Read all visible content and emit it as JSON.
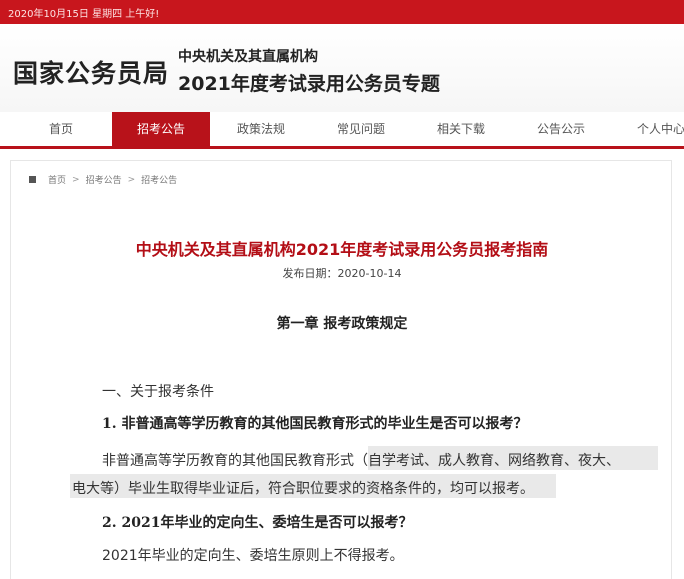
{
  "topbar": {
    "date_text": "2020年10月15日  星期四  上午好!"
  },
  "header": {
    "logo": "国家公务员局",
    "subtitle_line1": "中央机关及其直属机构",
    "subtitle_line2": "2021年度考试录用公务员专题"
  },
  "nav": {
    "items": [
      {
        "label": "首页"
      },
      {
        "label": "招考公告"
      },
      {
        "label": "政策法规"
      },
      {
        "label": "常见问题"
      },
      {
        "label": "相关下载"
      },
      {
        "label": "公告公示"
      },
      {
        "label": "个人中心"
      }
    ],
    "active_index": 1
  },
  "breadcrumb": {
    "items": [
      "首页",
      "招考公告",
      "招考公告"
    ],
    "separator": ">"
  },
  "article": {
    "title": "中央机关及其直属机构2021年度考试录用公务员报考指南",
    "publish_date": "发布日期：2020-10-14",
    "chapter": "第一章  报考政策规定",
    "section": "一、关于报考条件",
    "q1": "1. 非普通高等学历教育的其他国民教育形式的毕业生是否可以报考？",
    "a1_line1": "非普通高等学历教育的其他国民教育形式（自学考试、成人教育、网络教育、夜大、",
    "a1_line2": "电大等）毕业生取得毕业证后，符合职位要求的资格条件的，均可以报考。",
    "q2": "2. 2021年毕业的定向生、委培生是否可以报考？",
    "a2": "2021年毕业的定向生、委培生原则上不得报考。"
  },
  "colors": {
    "brand_red": "#c8161d",
    "title_red": "#b30e16",
    "highlight": "#e9e9e9"
  }
}
